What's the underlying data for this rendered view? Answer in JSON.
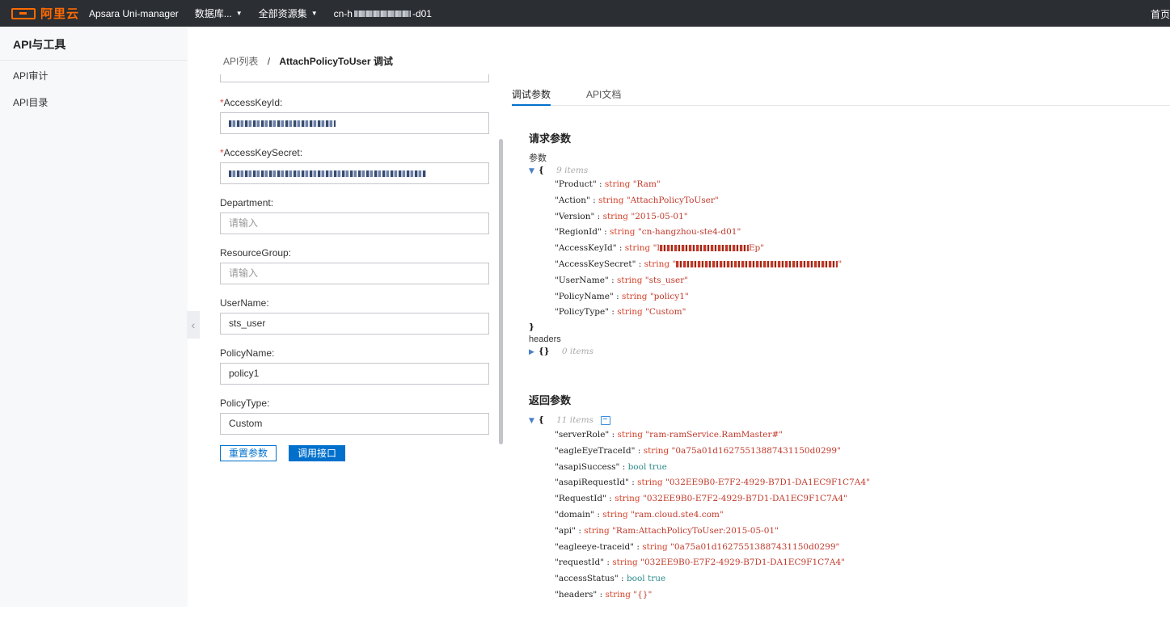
{
  "topbar": {
    "logo_text": "阿里云",
    "product": "Apsara Uni-manager",
    "menu_db": "数据库...",
    "menu_resource": "全部资源集",
    "region_prefix": "cn-h",
    "region_suffix": "-d01",
    "right_link": "首页",
    "icons": {
      "logo": "aliyun-logo-icon",
      "caret": "chevron-down-icon"
    }
  },
  "sidebar": {
    "title": "API与工具",
    "items": [
      {
        "label": "API审计"
      },
      {
        "label": "API目录"
      }
    ],
    "collapse_glyph": "‹"
  },
  "breadcrumb": {
    "root": "API列表",
    "sep": "/",
    "current": "AttachPolicyToUser 调试"
  },
  "form": {
    "fields": [
      {
        "label": "AccessKeyId:",
        "required": true,
        "value": "",
        "masked": true
      },
      {
        "label": "AccessKeySecret:",
        "required": true,
        "value": "",
        "masked": true
      },
      {
        "label": "Department:",
        "required": false,
        "placeholder": "请输入"
      },
      {
        "label": "ResourceGroup:",
        "required": false,
        "placeholder": "请输入"
      },
      {
        "label": "UserName:",
        "required": false,
        "value": "sts_user"
      },
      {
        "label": "PolicyName:",
        "required": false,
        "value": "policy1"
      },
      {
        "label": "PolicyType:",
        "required": false,
        "value": "Custom"
      }
    ],
    "required_mark": "*",
    "reset_button": "重置参数",
    "call_button": "调用接口"
  },
  "tabs": [
    {
      "label": "调试参数",
      "active": true
    },
    {
      "label": "API文档",
      "active": false
    }
  ],
  "request": {
    "title": "请求参数",
    "params_label": "参数",
    "params_meta": "9 items",
    "rows": [
      {
        "key": "\"Product\"",
        "type": "string",
        "value": "\"Ram\""
      },
      {
        "key": "\"Action\"",
        "type": "string",
        "value": "\"AttachPolicyToUser\""
      },
      {
        "key": "\"Version\"",
        "type": "string",
        "value": "\"2015-05-01\""
      },
      {
        "key": "\"RegionId\"",
        "type": "string",
        "value": "\"cn-hangzhou-ste4-d01\""
      },
      {
        "key": "\"AccessKeyId\"",
        "type": "string",
        "value": "\"l",
        "value_tail": "Ep\"",
        "masked": true
      },
      {
        "key": "\"AccessKeySecret\"",
        "type": "string",
        "value": "\"",
        "value_tail": "\"",
        "masked": true
      },
      {
        "key": "\"UserName\"",
        "type": "string",
        "value": "\"sts_user\""
      },
      {
        "key": "\"PolicyName\"",
        "type": "string",
        "value": "\"policy1\""
      },
      {
        "key": "\"PolicyType\"",
        "type": "string",
        "value": "\"Custom\""
      }
    ],
    "headers_label": "headers",
    "headers_braces": "{}",
    "headers_meta": "0 items"
  },
  "response": {
    "title": "返回参数",
    "meta": "11 items",
    "rows": [
      {
        "key": "\"serverRole\"",
        "type": "string",
        "value": "\"ram-ramService.RamMaster#\""
      },
      {
        "key": "\"eagleEyeTraceId\"",
        "type": "string",
        "value": "\"0a75a01d16275513887431150d0299\""
      },
      {
        "key": "\"asapiSuccess\"",
        "type": "bool",
        "value": "true"
      },
      {
        "key": "\"asapiRequestId\"",
        "type": "string",
        "value": "\"032EE9B0-E7F2-4929-B7D1-DA1EC9F1C7A4\""
      },
      {
        "key": "\"RequestId\"",
        "type": "string",
        "value": "\"032EE9B0-E7F2-4929-B7D1-DA1EC9F1C7A4\""
      },
      {
        "key": "\"domain\"",
        "type": "string",
        "value": "\"ram.cloud.ste4.com\""
      },
      {
        "key": "\"api\"",
        "type": "string",
        "value": "\"Ram:AttachPolicyToUser:2015-05-01\""
      },
      {
        "key": "\"eagleeye-traceid\"",
        "type": "string",
        "value": "\"0a75a01d16275513887431150d0299\""
      },
      {
        "key": "\"requestId\"",
        "type": "string",
        "value": "\"032EE9B0-E7F2-4929-B7D1-DA1EC9F1C7A4\""
      },
      {
        "key": "\"accessStatus\"",
        "type": "bool",
        "value": "true"
      },
      {
        "key": "\"headers\"",
        "type": "string",
        "value": "\"{}\""
      }
    ]
  },
  "colors": {
    "accent": "#0070cc",
    "brand": "#ff6a00",
    "topbar": "#2b2e33",
    "required": "#e5483b"
  }
}
